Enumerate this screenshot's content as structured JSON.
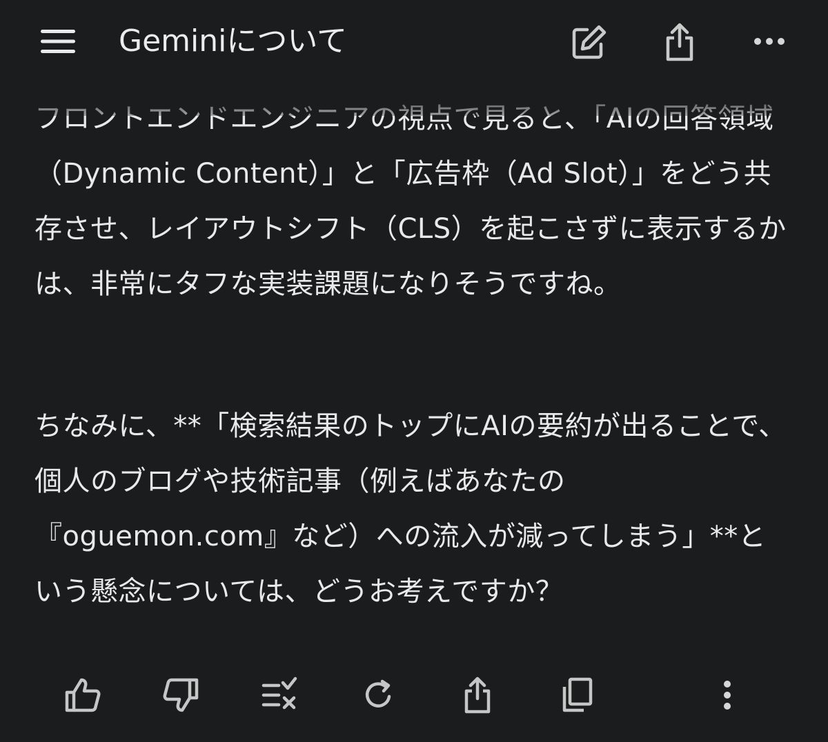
{
  "header": {
    "title": "Geminiについて",
    "icons": {
      "menu": "hamburger-menu-icon",
      "new_chat": "edit-square-icon",
      "share": "share-icon",
      "more": "more-horizontal-icon"
    }
  },
  "message": {
    "paragraph1": "フロントエンドエンジニアの視点で見ると、「AIの回答領域（Dynamic Content）」と「広告枠（Ad Slot）」をどう共存させ、レイアウトシフト（CLS）を起こさずに表示するかは、非常にタフな実装課題になりそうですね。",
    "paragraph2": "ちなみに、**「検索結果のトップにAIの要約が出ることで、個人のブログや技術記事（例えばあなたの『oguemon.com』など）への流入が減ってしまう」**という懸念については、どうお考えですか？"
  },
  "actions": {
    "icons": [
      "thumbs-up-icon",
      "thumbs-down-icon",
      "modify-response-icon",
      "regenerate-icon",
      "share-icon",
      "copy-icon",
      "more-vertical-icon"
    ]
  },
  "colors": {
    "background": "#1b1c1d",
    "text": "#e8e9ea",
    "icon": "#c4c7c5"
  }
}
